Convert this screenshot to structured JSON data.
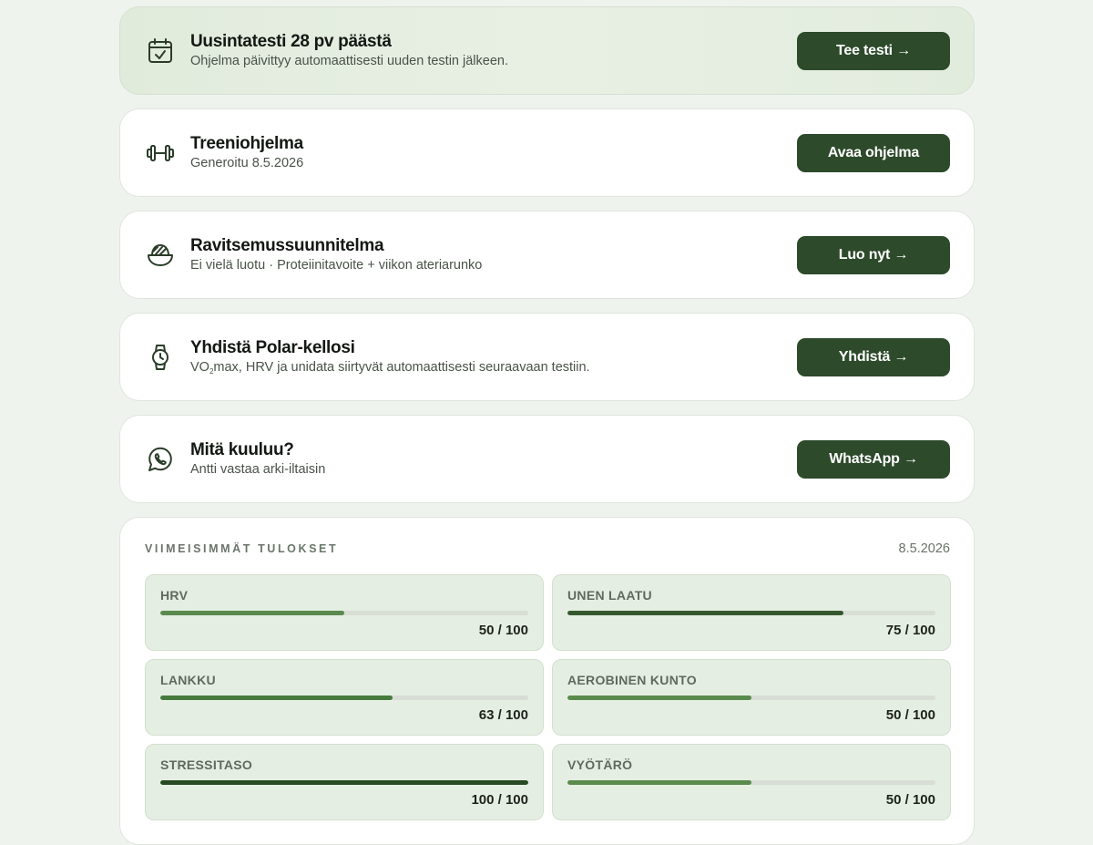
{
  "cards": [
    {
      "title": "Uusintatesti 28 pv päästä",
      "subtitle": "Ohjelma päivittyy automaattisesti uuden testin jälkeen.",
      "button": "Tee testi →",
      "icon": "calendar-check-icon"
    },
    {
      "title": "Treeniohjelma",
      "subtitle": "Generoitu 8.5.2026",
      "button": "Avaa ohjelma",
      "icon": "dumbbell-icon"
    },
    {
      "title": "Ravitsemussuunnitelma",
      "subtitle": "Ei vielä luotu · Proteiinitavoite + viikon ateriarunko",
      "button": "Luo nyt →",
      "icon": "bowl-icon"
    },
    {
      "title": "Yhdistä Polar-kellosi",
      "subtitle_prefix": "VO",
      "subtitle_sub": "2",
      "subtitle_rest": "max, HRV ja unidata siirtyvät automaattisesti seuraavaan testiin.",
      "button": "Yhdistä →",
      "icon": "watch-icon"
    },
    {
      "title": "Mitä kuuluu?",
      "subtitle": "Antti vastaa arki-iltaisin",
      "button": "WhatsApp →",
      "icon": "whatsapp-icon"
    }
  ],
  "results": {
    "heading": "VIIMEISIMMÄT TULOKSET",
    "date": "8.5.2026",
    "metrics": [
      {
        "name": "HRV",
        "value": 50,
        "max": 100,
        "label": "50 / 100",
        "color": "#5a8a4e"
      },
      {
        "name": "UNEN LAATU",
        "value": 75,
        "max": 100,
        "label": "75 / 100",
        "color": "#34582d"
      },
      {
        "name": "LANKKU",
        "value": 63,
        "max": 100,
        "label": "63 / 100",
        "color": "#477a3d"
      },
      {
        "name": "AEROBINEN KUNTO",
        "value": 50,
        "max": 100,
        "label": "50 / 100",
        "color": "#5a8a4e"
      },
      {
        "name": "STRESSITASO",
        "value": 100,
        "max": 100,
        "label": "100 / 100",
        "color": "#274a23"
      },
      {
        "name": "VYÖTÄRÖ",
        "value": 50,
        "max": 100,
        "label": "50 / 100",
        "color": "#5a8a4e"
      }
    ]
  },
  "colors": {
    "accent": "#2d4a2b",
    "background": "#eff3ee",
    "highlight_card": "#e4eddf",
    "metric_card": "#e5eee2"
  }
}
